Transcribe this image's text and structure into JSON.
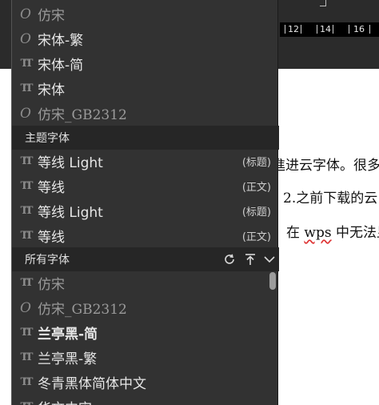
{
  "ruler": {
    "labels": [
      "12",
      "14",
      "16"
    ]
  },
  "document": {
    "lines": [
      "進进云字体。很多",
      "2.之前下载的云",
      "在",
      "wps",
      "中无法显"
    ]
  },
  "panel": {
    "top_fonts": [
      {
        "name": "仿宋",
        "icon": "opentype-o-icon"
      },
      {
        "name": "宋体-繁",
        "icon": "opentype-o-icon"
      },
      {
        "name": "宋体-简",
        "icon": "truetype-tt-icon"
      },
      {
        "name": "宋体",
        "icon": "truetype-tt-icon"
      },
      {
        "name": "仿宋_GB2312",
        "icon": "opentype-o-icon"
      }
    ],
    "theme_section": {
      "title": "主题字体",
      "fonts": [
        {
          "name": "等线 Light",
          "tag": "(标题)"
        },
        {
          "name": "等线",
          "tag": "(正文)"
        },
        {
          "name": "等线 Light",
          "tag": "(标题)"
        },
        {
          "name": "等线",
          "tag": "(正文)"
        }
      ]
    },
    "all_section": {
      "title": "所有字体",
      "controls": [
        "refresh-icon",
        "scroll-to-top-icon",
        "chevron-down-icon"
      ],
      "fonts": [
        {
          "name": "仿宋"
        },
        {
          "name": "仿宋_GB2312"
        },
        {
          "name": "兰亭黑-简"
        },
        {
          "name": "兰亭黑-繁"
        },
        {
          "name": "冬青黑体简体中文"
        },
        {
          "name": "华文中宋"
        }
      ]
    }
  },
  "colors": {
    "panel_bg": "#323232",
    "section_bg": "#262626",
    "text": "#e6e6e6",
    "doc_bg": "#ffffff"
  }
}
